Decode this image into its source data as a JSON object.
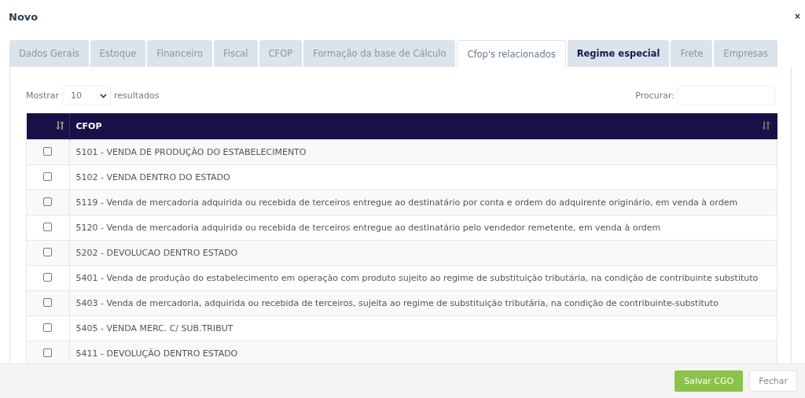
{
  "window": {
    "title": "Novo",
    "close": "×"
  },
  "tabs": [
    {
      "label": "Dados Gerais",
      "selected": false,
      "hovered": false
    },
    {
      "label": "Estoque",
      "selected": false,
      "hovered": false
    },
    {
      "label": "Financeiro",
      "selected": false,
      "hovered": false
    },
    {
      "label": "Fiscal",
      "selected": false,
      "hovered": false
    },
    {
      "label": "CFOP",
      "selected": false,
      "hovered": false
    },
    {
      "label": "Formação da base de Cálculo",
      "selected": false,
      "hovered": false
    },
    {
      "label": "Cfop's relacionados",
      "selected": true,
      "hovered": false
    },
    {
      "label": "Regime especial",
      "selected": false,
      "hovered": true
    },
    {
      "label": "Frete",
      "selected": false,
      "hovered": false
    },
    {
      "label": "Empresas",
      "selected": false,
      "hovered": false
    }
  ],
  "length": {
    "before": "Mostrar",
    "value": "10",
    "after": "resultados"
  },
  "search": {
    "label": "Procurar:"
  },
  "table": {
    "columns": [
      "CFOP"
    ],
    "rows": [
      {
        "checked": false,
        "cfop": "5101 - VENDA DE PRODUÇÃO DO ESTABELECIMENTO"
      },
      {
        "checked": false,
        "cfop": "5102 - VENDA DENTRO DO ESTADO"
      },
      {
        "checked": false,
        "cfop": "5119 - Venda de mercadoria adquirida ou recebida de terceiros entregue ao destinatário por conta e ordem do adquirente originário, em venda à ordem"
      },
      {
        "checked": false,
        "cfop": "5120 - Venda de mercadoria adquirida ou recebida de terceiros entregue ao destinatário pelo vendedor remetente, em venda à ordem"
      },
      {
        "checked": false,
        "cfop": "5202 - DEVOLUCAO DENTRO ESTADO"
      },
      {
        "checked": false,
        "cfop": "5401 - Venda de produção do estabelecimento em operação com produto sujeito ao regime de substituição tributária, na condição de contribuinte substituto"
      },
      {
        "checked": false,
        "cfop": "5403 - Venda de mercadoria, adquirida ou recebida de terceiros, sujeita ao regime de substituição tributária, na condição de contribuinte-substituto"
      },
      {
        "checked": false,
        "cfop": "5405 - VENDA MERC. C/ SUB.TRIBUT"
      },
      {
        "checked": false,
        "cfop": "5411 - DEVOLUÇÃO DENTRO ESTADO"
      }
    ]
  },
  "buttons": [
    {
      "label": "Salvar CGO",
      "kind": "primary"
    },
    {
      "label": "Fechar",
      "kind": "secondary"
    }
  ]
}
